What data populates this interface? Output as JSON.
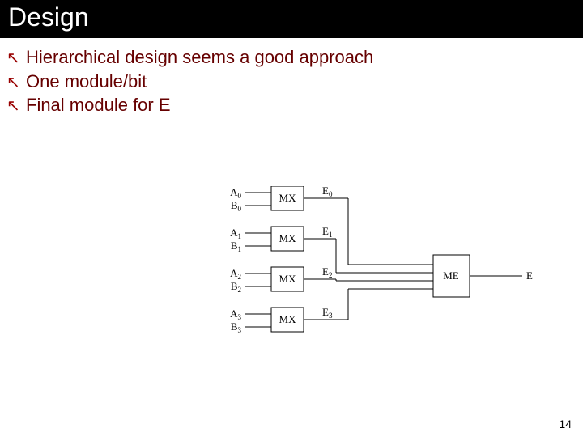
{
  "title": "Design",
  "bullets": [
    "Hierarchical design seems a good approach",
    "One module/bit",
    "Final module for E"
  ],
  "page_number": "14",
  "bullet_glyph": "↖",
  "diagram": {
    "mx_units": [
      {
        "inputs": [
          "A",
          "B"
        ],
        "idx": "0",
        "label": "MX",
        "out": "E",
        "out_idx": "0"
      },
      {
        "inputs": [
          "A",
          "B"
        ],
        "idx": "1",
        "label": "MX",
        "out": "E",
        "out_idx": "1"
      },
      {
        "inputs": [
          "A",
          "B"
        ],
        "idx": "2",
        "label": "MX",
        "out": "E",
        "out_idx": "2"
      },
      {
        "inputs": [
          "A",
          "B"
        ],
        "idx": "3",
        "label": "MX",
        "out": "E",
        "out_idx": "3"
      }
    ],
    "combiner": {
      "label": "ME",
      "out": "E"
    }
  }
}
